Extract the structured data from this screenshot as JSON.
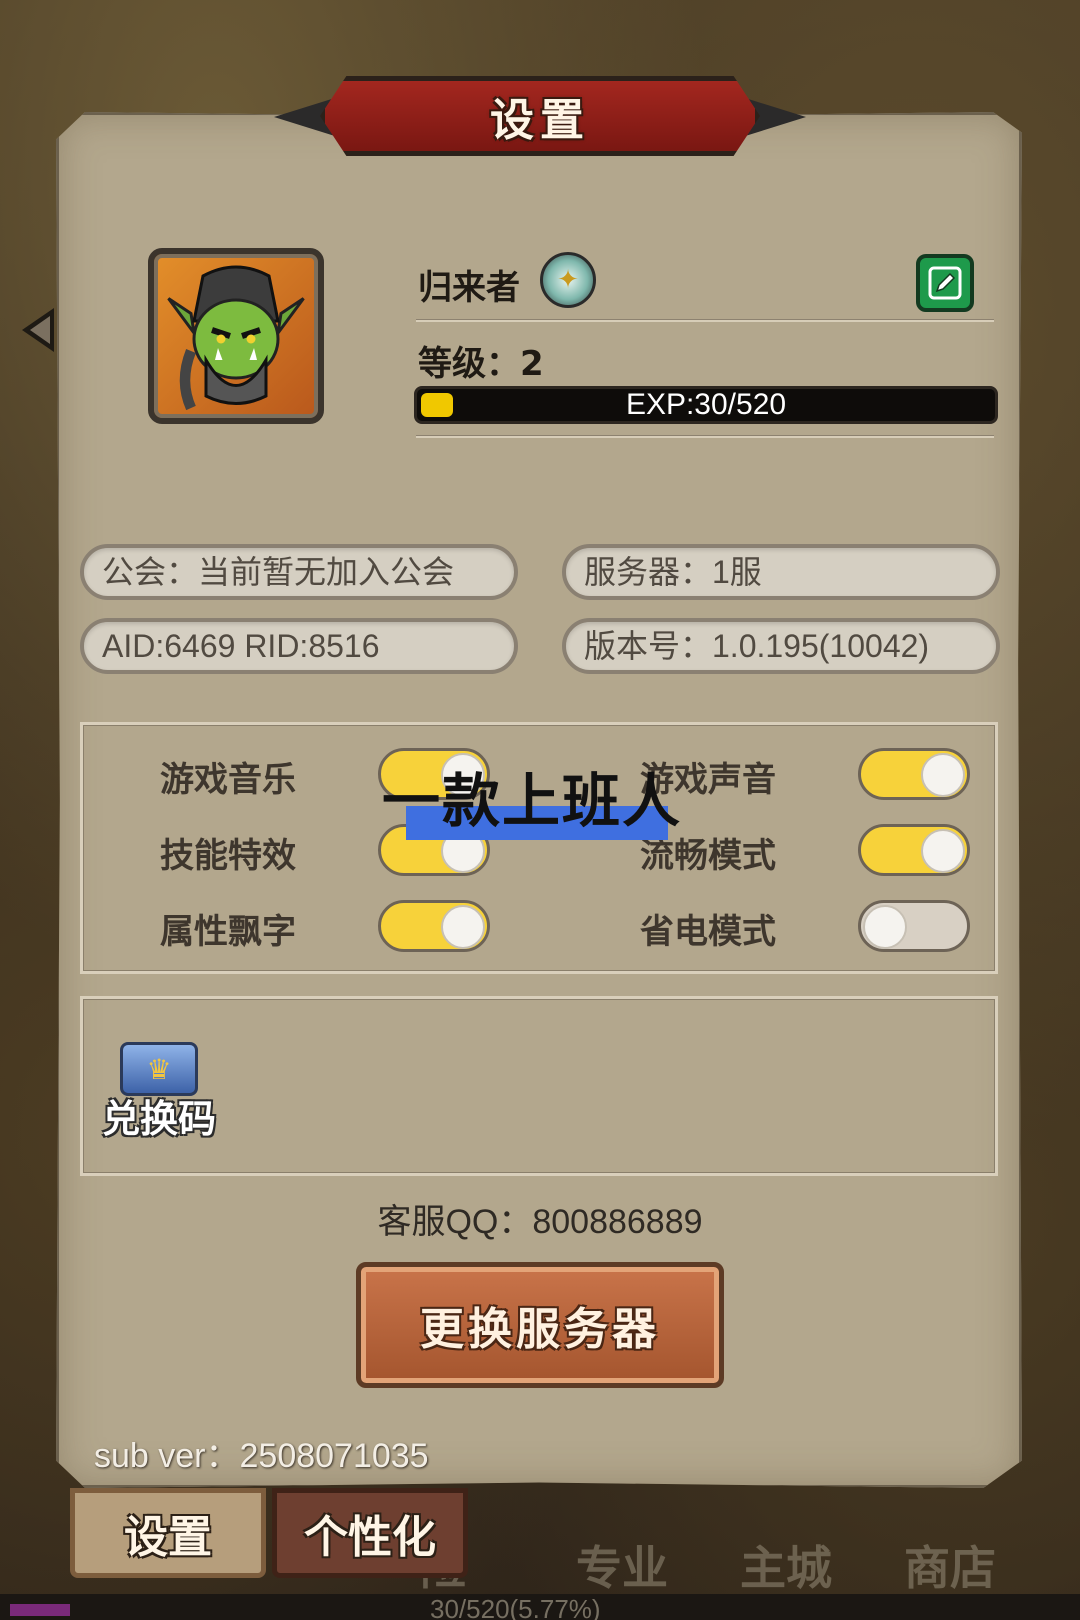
{
  "dialog": {
    "title": "设置"
  },
  "profile": {
    "name": "归来者",
    "level_text": "等级：2",
    "exp_text": "EXP:30/520",
    "exp_fraction": 0.0577
  },
  "info": {
    "guild": "公会：当前暂无加入公会",
    "server": "服务器：1服",
    "ids": "AID:6469   RID:8516",
    "version": "版本号：1.0.195(10042)"
  },
  "settings": [
    {
      "label": "游戏音乐",
      "on": true
    },
    {
      "label": "游戏声音",
      "on": true
    },
    {
      "label": "技能特效",
      "on": true
    },
    {
      "label": "流畅模式",
      "on": true
    },
    {
      "label": "属性飘字",
      "on": true
    },
    {
      "label": "省电模式",
      "on": false
    }
  ],
  "watermark": "一款上班人",
  "redeem": {
    "label": "兑换码"
  },
  "service_qq": "客服QQ：800886889",
  "switch_server_label": "更换服务器",
  "sub_ver": "sub ver：2508071035",
  "tabs": [
    {
      "label": "设置",
      "active": true
    },
    {
      "label": "个性化",
      "active": false
    }
  ],
  "background_nav": [
    "险",
    "专业",
    "主城",
    "商店"
  ],
  "bottom_progress_text": "30/520(5.77%)",
  "colors": {
    "toggle_on": "#f7d23a",
    "toggle_off": "#d8d0c4",
    "exp_fill": "#f0c800",
    "edit_green": "#1e9a4b"
  }
}
